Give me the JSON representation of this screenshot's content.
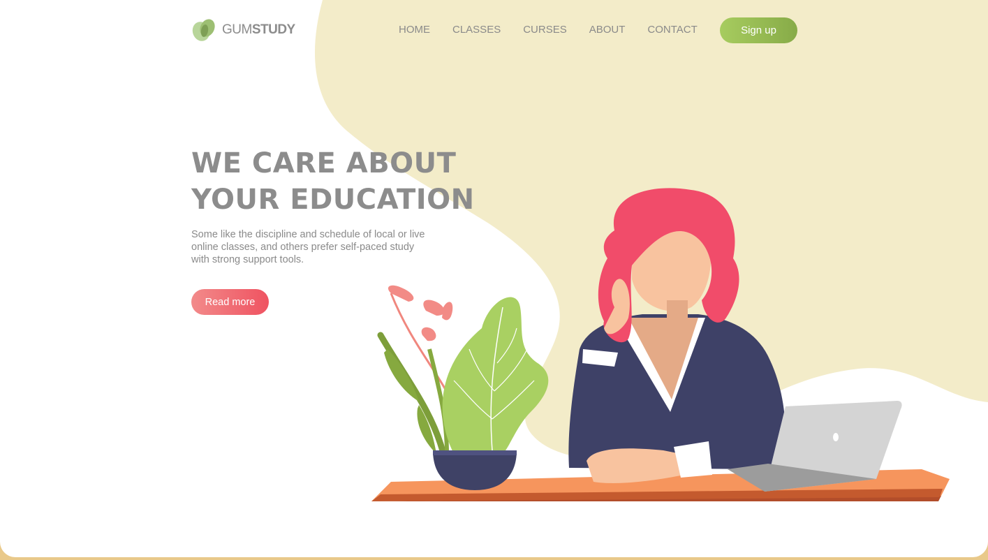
{
  "brand": {
    "name_light": "GUM",
    "name_bold": "STUDY",
    "logo_icon": "leaf-logo-icon"
  },
  "nav": {
    "items": [
      {
        "label": "HOME"
      },
      {
        "label": "CLASSES"
      },
      {
        "label": "CURSES"
      },
      {
        "label": "ABOUT"
      },
      {
        "label": "CONTACT"
      }
    ]
  },
  "header": {
    "signup_label": "Sign up"
  },
  "hero": {
    "title_line1": "WE CARE ABOUT",
    "title_line2": "YOUR EDUCATION",
    "description": "Some like the discipline and schedule of local or live online classes, and others prefer self-paced study with strong support tools.",
    "cta_label": "Read more"
  },
  "illustration": {
    "subject": "woman-at-desk-with-laptop-and-plant"
  },
  "colors": {
    "accent_green": "#a7cc5f",
    "accent_red": "#ef5361",
    "blob": "#f3ecc9",
    "text_gray": "#8c8c8c"
  }
}
